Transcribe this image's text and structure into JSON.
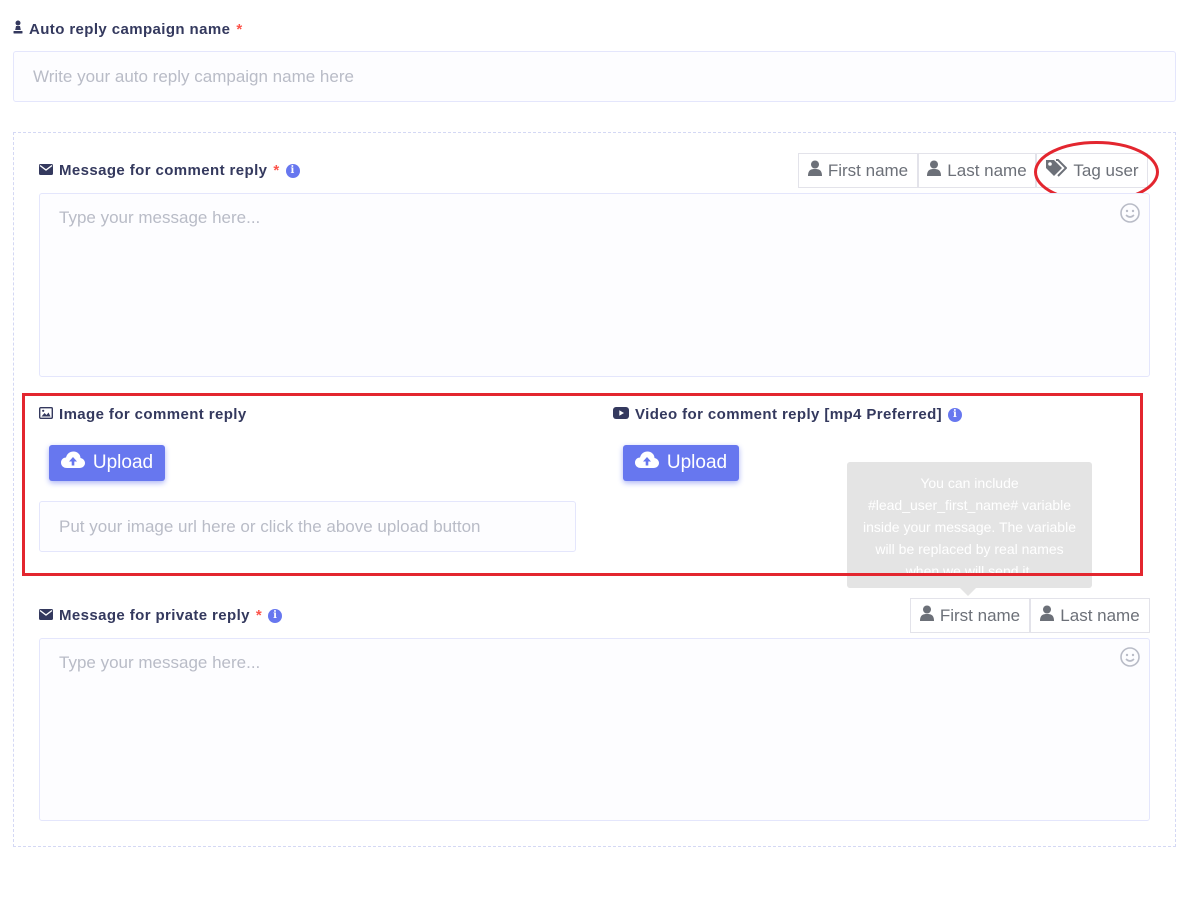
{
  "campaign": {
    "label": "Auto reply campaign name",
    "required_mark": "*",
    "placeholder": "Write your auto reply campaign name here"
  },
  "comment_reply": {
    "label": "Message for comment reply",
    "required_mark": "*",
    "placeholder": "Type your message here...",
    "chips": {
      "first_name": "First name",
      "last_name": "Last name",
      "tag_user": "Tag user"
    }
  },
  "image_reply": {
    "label": "Image for comment reply",
    "upload_label": "Upload",
    "url_placeholder": "Put your image url here or click the above upload button"
  },
  "video_reply": {
    "label": "Video for comment reply [mp4 Preferred]",
    "upload_label": "Upload"
  },
  "tooltip": {
    "text": "You can include #lead_user_first_name# variable inside your message. The variable will be replaced by real names when we will send it."
  },
  "private_reply": {
    "label": "Message for private reply",
    "required_mark": "*",
    "placeholder": "Type your message here...",
    "chips": {
      "first_name": "First name",
      "last_name": "Last name"
    }
  },
  "icons": {
    "campaign": "chess-pawn-icon",
    "envelope": "envelope-icon",
    "info": "info-circle-icon",
    "user": "user-icon",
    "tag": "tags-icon",
    "emoji": "smile-icon",
    "image": "image-icon",
    "video": "youtube-icon",
    "upload": "cloud-upload-icon"
  },
  "colors": {
    "primary": "#6777ef",
    "required": "#fc544b",
    "annotation": "#e3262f"
  }
}
